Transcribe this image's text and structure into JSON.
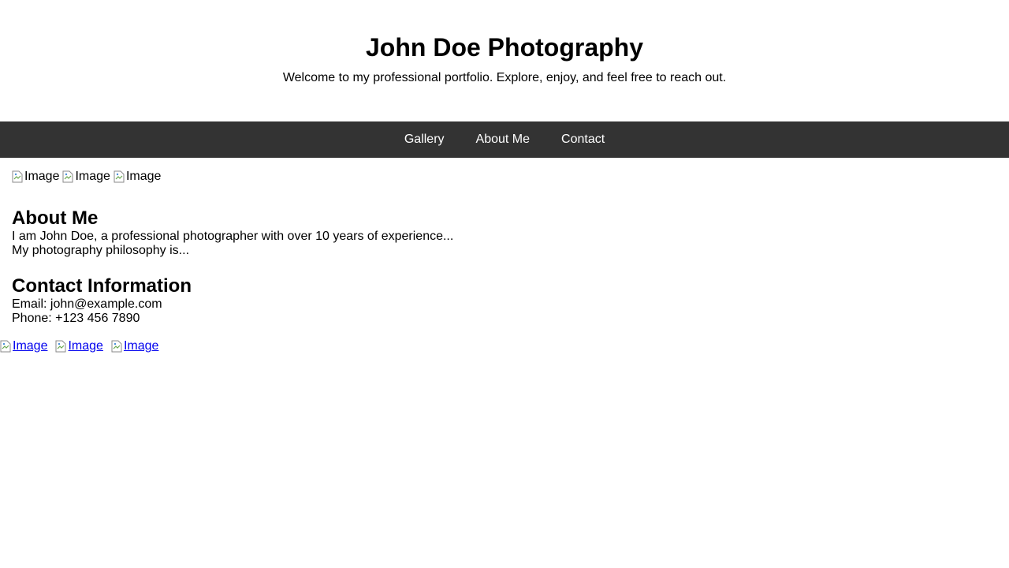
{
  "header": {
    "title": "John Doe Photography",
    "tagline": "Welcome to my professional portfolio. Explore, enjoy, and feel free to reach out."
  },
  "nav": {
    "items": [
      {
        "label": "Gallery"
      },
      {
        "label": "About Me"
      },
      {
        "label": "Contact"
      }
    ]
  },
  "gallery": {
    "images": [
      {
        "alt": "Image"
      },
      {
        "alt": "Image"
      },
      {
        "alt": "Image"
      }
    ]
  },
  "about": {
    "heading": "About Me",
    "paragraphs": [
      "I am John Doe, a professional photographer with over 10 years of experience...",
      "My photography philosophy is..."
    ]
  },
  "contact": {
    "heading": "Contact Information",
    "email": "Email: john@example.com",
    "phone": "Phone: +123 456 7890"
  },
  "footer": {
    "links": [
      {
        "alt": "Image"
      },
      {
        "alt": "Image"
      },
      {
        "alt": "Image"
      }
    ]
  },
  "colors": {
    "nav_background": "#333333",
    "nav_text": "#ffffff",
    "link": "#0000ee"
  }
}
